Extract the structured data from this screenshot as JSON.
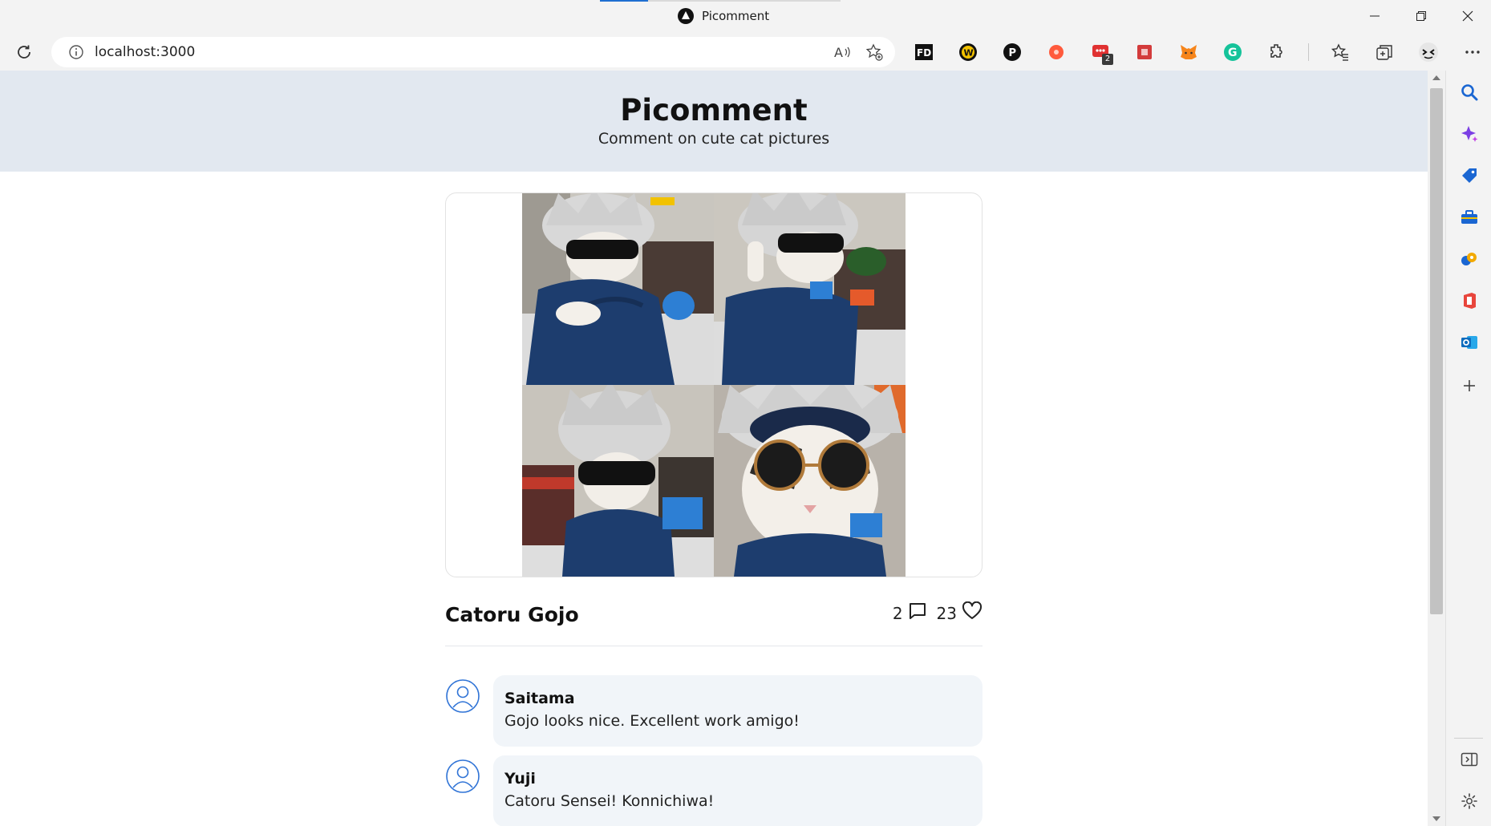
{
  "window": {
    "title": "Picomment",
    "controls": {
      "minimize": "—",
      "restore": "❐",
      "close": "✕"
    }
  },
  "toolbar": {
    "url": "localhost:3000",
    "extensions": [
      {
        "name": "fd-extension",
        "label": "FD",
        "color": "#111111"
      },
      {
        "name": "w-extension",
        "label": "W",
        "color": "#f2c200"
      },
      {
        "name": "p-extension",
        "label": "P",
        "color": "#111111"
      },
      {
        "name": "red-dot-extension",
        "label": "",
        "color": "#ff5a3c"
      },
      {
        "name": "chat-extension",
        "label": "",
        "color": "#e03131",
        "badge": "2"
      },
      {
        "name": "puzzle-red-extension",
        "label": "",
        "color": "#d33b3b"
      },
      {
        "name": "metamask-extension",
        "label": "",
        "color": "#f6851b"
      },
      {
        "name": "grammarly-extension",
        "label": "G",
        "color": "#15c39a"
      }
    ]
  },
  "site": {
    "title": "Picomment",
    "subtitle": "Comment on cute cat pictures"
  },
  "post": {
    "title": "Catoru Gojo",
    "comment_count": "2",
    "like_count": "23",
    "comments": [
      {
        "author": "Saitama",
        "text": "Gojo looks nice. Excellent work amigo!"
      },
      {
        "author": "Yuji",
        "text": "Catoru Sensei! Konnichiwa!"
      }
    ]
  },
  "sidebar": {
    "icons": [
      "search-icon",
      "copilot-icon",
      "shopping-tag-icon",
      "toolbox-icon",
      "games-icon",
      "office-icon",
      "outlook-icon",
      "add-icon"
    ]
  }
}
